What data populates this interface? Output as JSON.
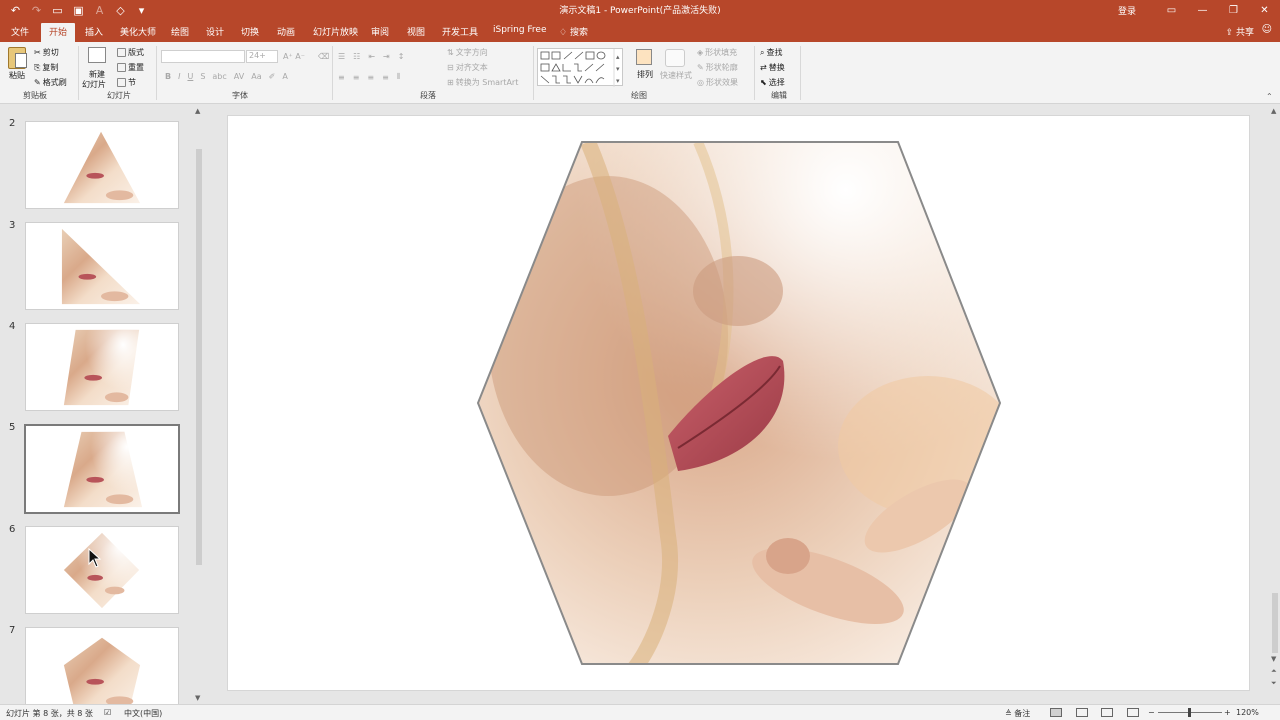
{
  "app": {
    "title": "演示文稿1 - PowerPoint(产品激活失败)",
    "login": "登录",
    "window_buttons": [
      "ribbon-display",
      "minimize",
      "restore",
      "close"
    ]
  },
  "qat": {
    "icons": [
      "undo-icon",
      "redo-icon",
      "start-from-beginning-icon",
      "save-icon",
      "font-color-icon",
      "shape-fill-icon",
      "customize-qat-icon"
    ]
  },
  "tabs": [
    "文件",
    "开始",
    "插入",
    "美化大师",
    "绘图",
    "设计",
    "切换",
    "动画",
    "幻灯片放映",
    "审阅",
    "视图",
    "开发工具",
    "iSpring Free"
  ],
  "active_tab": "开始",
  "search_label": "搜索",
  "share_label": "共享",
  "ribbon": {
    "clipboard": {
      "paste": "粘贴",
      "cut": "剪切",
      "copy": "复制",
      "format_painter": "格式刷",
      "label": "剪贴板"
    },
    "slides": {
      "new_slide": "新建",
      "new_slide2": "幻灯片",
      "layout": "版式",
      "reset": "重置",
      "section": "节",
      "label": "幻灯片"
    },
    "font": {
      "font_name": "",
      "font_size": "24+",
      "bold": "B",
      "italic": "I",
      "underline": "U",
      "strike": "S",
      "shadow": "abc",
      "spacing": "AV",
      "case": "Aa",
      "color": "A",
      "label": "字体"
    },
    "paragraph": {
      "text_direction": "文字方向",
      "align_text": "对齐文本",
      "convert_smartart": "转换为 SmartArt",
      "label": "段落"
    },
    "drawing": {
      "arrange": "排列",
      "quick_styles": "快速样式",
      "shape_fill": "形状填充",
      "shape_outline": "形状轮廓",
      "shape_effects": "形状效果",
      "label": "绘图"
    },
    "editing": {
      "find": "查找",
      "replace": "替换",
      "select": "选择",
      "label": "编辑"
    }
  },
  "thumbnails": [
    {
      "num": "2",
      "shape": "triangle"
    },
    {
      "num": "3",
      "shape": "right-triangle"
    },
    {
      "num": "4",
      "shape": "parallelogram"
    },
    {
      "num": "5",
      "shape": "trapezoid",
      "selected": true
    },
    {
      "num": "6",
      "shape": "diamond"
    },
    {
      "num": "7",
      "shape": "pentagon"
    }
  ],
  "slide": {
    "shape": "hexagon"
  },
  "status": {
    "slide_info": "幻灯片 第 8 张，共 8 张",
    "language": "中文(中国)",
    "notes": "备注",
    "zoom": "120%"
  },
  "colors": {
    "brand": "#b7472a",
    "ribbon_bg": "#f3f3f3",
    "pane_bg": "#e6e6e6"
  }
}
